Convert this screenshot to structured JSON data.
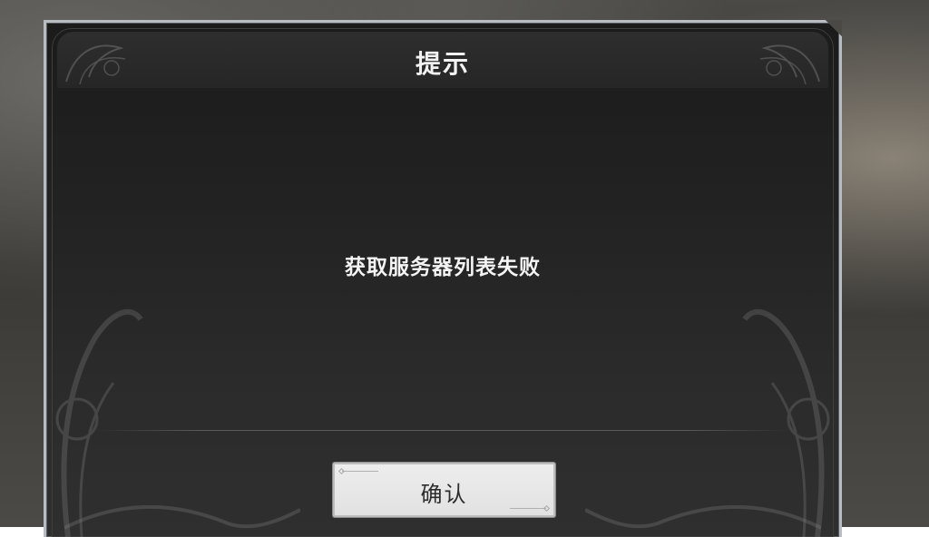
{
  "dialog": {
    "title": "提示",
    "message": "获取服务器列表失败",
    "confirm_label": "确认"
  },
  "colors": {
    "panel_bg": "#222222",
    "frame_border": "#b9bcc0",
    "title_text": "#f2f2f2",
    "message_text": "#f4f4f4",
    "button_bg": "#e8e8e8",
    "button_text": "#2d2d2d"
  },
  "icons": {
    "title_ornament": "filigree-ornament-icon",
    "side_ornament": "scroll-ornament-icon"
  }
}
